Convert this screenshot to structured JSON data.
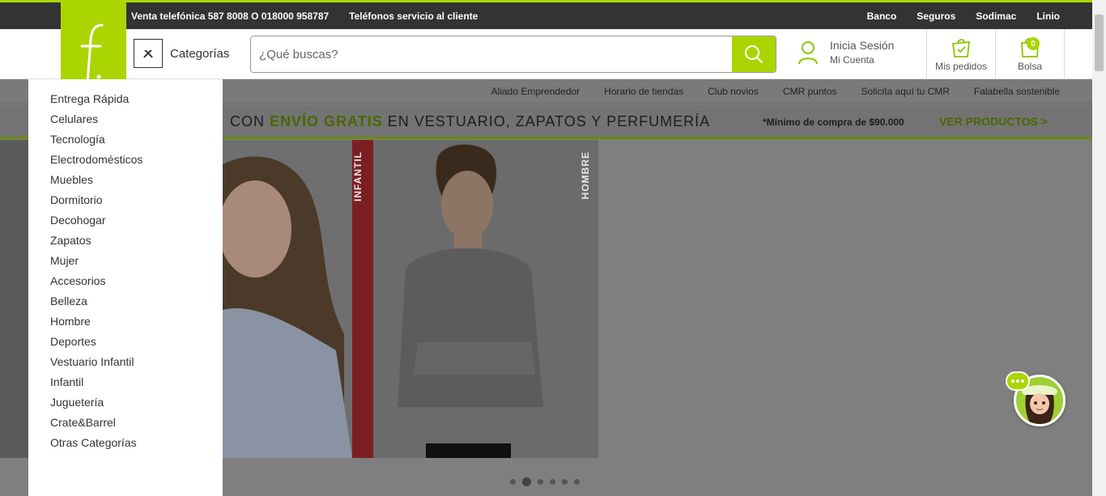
{
  "topbar": {
    "phone_sales": "Venta telefónica 587 8008 O 018000 958787",
    "customer_service": "Teléfonos servicio al cliente",
    "links": [
      "Banco",
      "Seguros",
      "Sodimac",
      "Linio"
    ]
  },
  "header": {
    "categories_label": "Categorías",
    "close_glyph": "✕",
    "search_placeholder": "¿Qué buscas?",
    "login_title": "Inicia Sesión",
    "login_sub": "Mi Cuenta",
    "orders_label": "Mis pedidos",
    "bag_label": "Bolsa",
    "bag_count": "0"
  },
  "subnav": [
    "Aliado Emprendedor",
    "Horario de tiendas",
    "Club novios",
    "CMR puntos",
    "Solicita aquí tu CMR",
    "Falabella sostenible"
  ],
  "promo": {
    "prefix": "CON ",
    "highlight": "ENVÍO GRATIS",
    "suffix": " EN VESTUARIO, ZAPATOS  Y PERFUMERÍA",
    "minimum": "*Mínimo de compra de $90.000",
    "cta": "VER PRODUCTOS >"
  },
  "hero": {
    "label_infantil": "INFANTIL",
    "label_hombre": "HOMBRE",
    "carousel_count": 6,
    "carousel_active": 2
  },
  "menu": {
    "items": [
      "Entrega Rápida",
      "Celulares",
      "Tecnología",
      "Electrodomésticos",
      "Muebles",
      "Dormitorio",
      "Decohogar",
      "Zapatos",
      "Mujer",
      "Accesorios",
      "Belleza",
      "Hombre",
      "Deportes",
      "Vestuario Infantil",
      "Infantil",
      "Juguetería",
      "Crate&Barrel",
      "Otras Categorías"
    ]
  },
  "colors": {
    "brand_green": "#aad500",
    "topbar": "#333333",
    "overlay": "#7f7f7f"
  },
  "icons": [
    "logo-f-icon",
    "close-icon",
    "search-icon",
    "user-icon",
    "orders-bag-icon",
    "shopping-bag-icon",
    "chat-icon"
  ]
}
